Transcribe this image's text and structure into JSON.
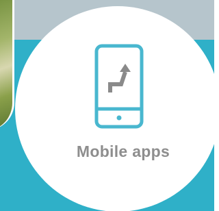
{
  "tile": {
    "label": "Mobile apps",
    "icon": "mobile-phone-arrow-icon"
  },
  "colors": {
    "background": "#2fb0c8",
    "top_band": "#b6c5cc",
    "tile": "#ffffff",
    "icon_outline": "#49b7cf",
    "icon_arrow": "#8a8a8a",
    "label": "#8e8e8e"
  }
}
